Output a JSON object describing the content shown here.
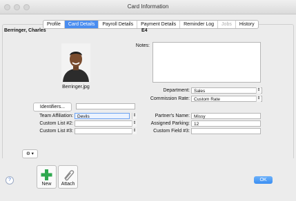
{
  "window": {
    "title": "Card Information"
  },
  "tabs": [
    {
      "label": "Profile",
      "state": "normal"
    },
    {
      "label": "Card Details",
      "state": "active"
    },
    {
      "label": "Payroll Details",
      "state": "normal"
    },
    {
      "label": "Payment Details",
      "state": "normal"
    },
    {
      "label": "Reminder Log",
      "state": "normal"
    },
    {
      "label": "Jobs",
      "state": "disabled"
    },
    {
      "label": "History",
      "state": "normal"
    }
  ],
  "card": {
    "name": "Berringer, Charles",
    "code": "E4",
    "photo_filename": "Berringer.jpg"
  },
  "notes": {
    "label": "Notes:",
    "value": ""
  },
  "department": {
    "label": "Department:",
    "value": "Sales"
  },
  "commission_rate": {
    "label": "Commission Rate:",
    "value": "Custom Rate"
  },
  "identifiers": {
    "button_label": "Identifiers...",
    "value": ""
  },
  "team_affiliation": {
    "label": "Team Affiliation:",
    "value": "Devils"
  },
  "custom_list_2": {
    "label": "Custom List #2:",
    "value": ""
  },
  "custom_list_3": {
    "label": "Custom List #3:",
    "value": ""
  },
  "partners_name": {
    "label": "Partner's Name:",
    "value": "Missy"
  },
  "assigned_parking": {
    "label": "Assigned Parking:",
    "value": "12"
  },
  "custom_field_3": {
    "label": "Custom Field #3:",
    "value": ""
  },
  "toolbar": {
    "new_label": "New",
    "attach_label": "Attach",
    "ok_label": "OK",
    "help_glyph": "?",
    "gear_glyph": "⚙ ▾"
  },
  "icons": {
    "new": "plus-icon",
    "attach": "paperclip-icon",
    "help": "help-icon",
    "gear": "gear-icon",
    "stepper": "stepper-arrows-icon"
  },
  "colors": {
    "accent": "#4a8df0",
    "ok": "#3b8ef2",
    "plus": "#2fa84f"
  }
}
